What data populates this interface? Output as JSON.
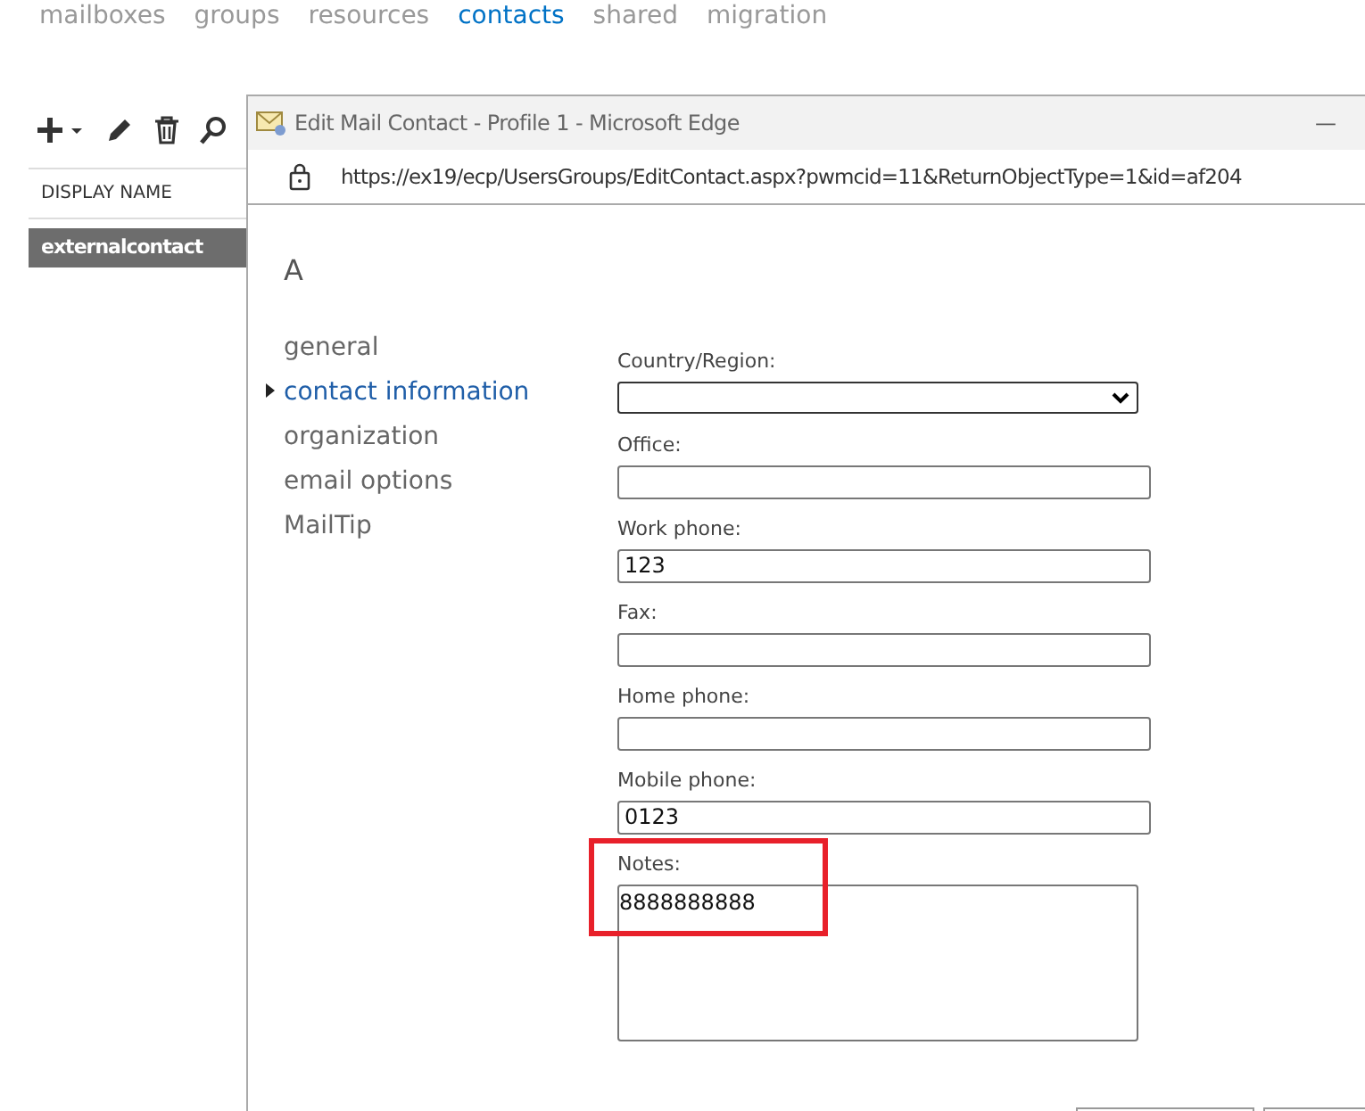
{
  "top_nav": [
    {
      "label": "mailboxes",
      "selected": false
    },
    {
      "label": "groups",
      "selected": false
    },
    {
      "label": "resources",
      "selected": false
    },
    {
      "label": "contacts",
      "selected": true
    },
    {
      "label": "shared",
      "selected": false
    },
    {
      "label": "migration",
      "selected": false
    }
  ],
  "list": {
    "column": "DISPLAY NAME",
    "rows": [
      {
        "name": "externalcontact",
        "selected": true
      }
    ]
  },
  "popup": {
    "title": "Edit Mail Contact - Profile 1 - Microsoft Edge",
    "minimize": "—",
    "url": "https://ex19/ecp/UsersGroups/EditContact.aspx?pwmcid=11&ReturnObjectType=1&id=af204",
    "heading": "A",
    "nav": [
      {
        "label": "general",
        "selected": false
      },
      {
        "label": "contact information",
        "selected": true
      },
      {
        "label": "organization",
        "selected": false
      },
      {
        "label": "email options",
        "selected": false
      },
      {
        "label": "MailTip",
        "selected": false
      }
    ],
    "fields": [
      {
        "kind": "select",
        "label": "Country/Region:"
      },
      {
        "kind": "text",
        "label": "Office:"
      },
      {
        "kind": "text",
        "label": "Work phone:",
        "value": "123"
      },
      {
        "kind": "text",
        "label": "Fax:"
      },
      {
        "kind": "text",
        "label": "Home phone:"
      },
      {
        "kind": "text",
        "label": "Mobile phone:",
        "value": "0123"
      },
      {
        "kind": "textarea",
        "label": "Notes:",
        "value": "8888888888",
        "highlighted": true
      }
    ]
  }
}
